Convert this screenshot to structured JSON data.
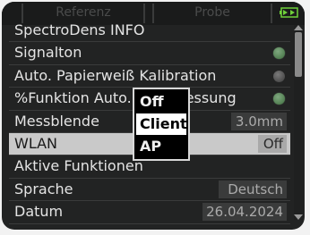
{
  "tabs": [
    {
      "label": "Referenz"
    },
    {
      "label": "Probe"
    }
  ],
  "menu": {
    "rows": [
      {
        "label": "SpectroDens INFO"
      },
      {
        "label": "Signalton",
        "indicator": "green"
      },
      {
        "label": "Auto. Papierweiß Kalibration",
        "indicator": "grey"
      },
      {
        "label": "%Funktion Auto. Weißmessung",
        "indicator": "green"
      },
      {
        "label": "Messblende",
        "value": "3.0mm"
      },
      {
        "label": "WLAN",
        "value": "Off"
      },
      {
        "label": "Aktive Funktionen"
      },
      {
        "label": "Sprache",
        "value": "Deutsch"
      },
      {
        "label": "Datum",
        "value": "26.04.2024"
      }
    ]
  },
  "popup": {
    "options": [
      "Off",
      "Client",
      "AP"
    ],
    "selected": "Client"
  },
  "colors": {
    "background": "#222323",
    "selected_row": "#c9c9c9",
    "indicator_green": "#4f7f4f",
    "indicator_grey": "#555555",
    "battery": "#6fd13a"
  },
  "icons": {
    "battery": "battery-icon"
  }
}
